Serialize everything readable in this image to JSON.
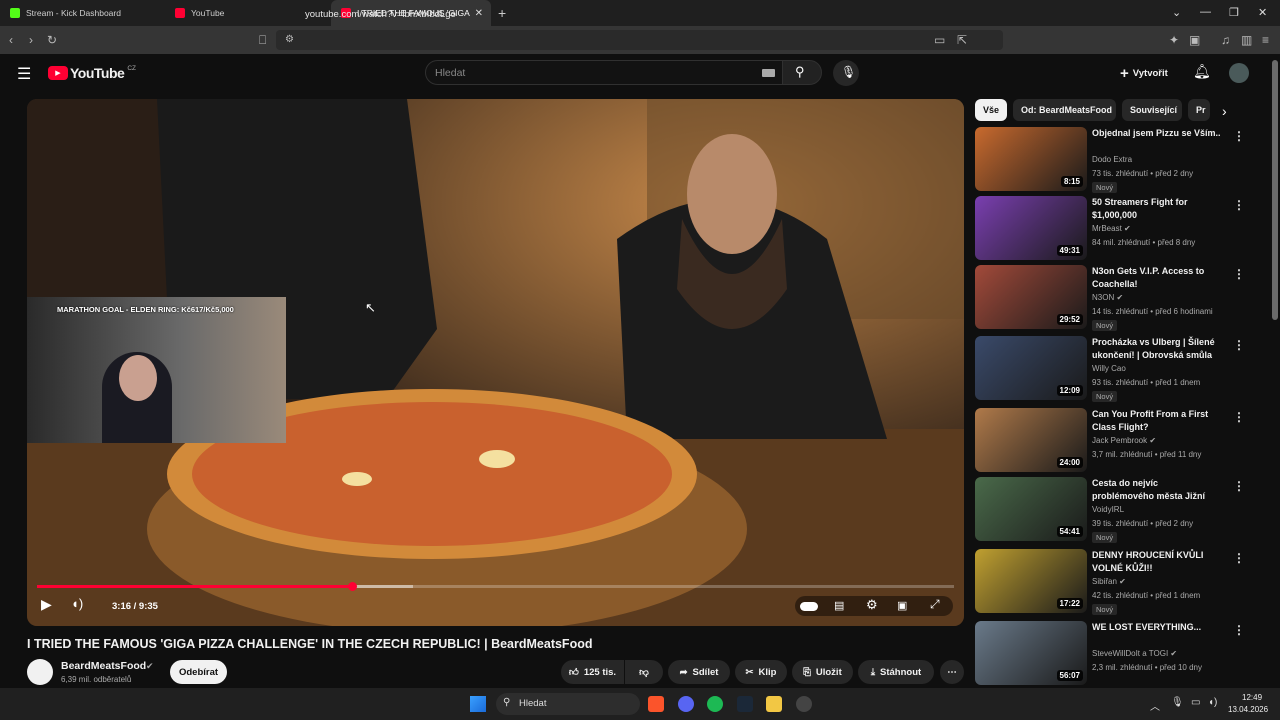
{
  "browser": {
    "tabs": [
      {
        "label": "Stream - Kick Dashboard",
        "color": "#53fc18"
      },
      {
        "label": "YouTube",
        "color": "#ff0033"
      },
      {
        "label": "I TRIED THE FAMOUS 'GIGA PIZZ",
        "color": "#ff0033"
      }
    ],
    "url": "youtube.com/watch?v=lbhXbIbdLgo"
  },
  "youtube": {
    "logo_text": "YouTube",
    "region": "CZ",
    "search_placeholder": "Hledat",
    "create_label": "Vytvořit"
  },
  "video": {
    "overlay_goal": "MARATHON GOAL - ELDEN RING: Kč617/Kč5,000",
    "time": "3:16 / 9:35",
    "progress": 0.343,
    "buffered": 0.41,
    "title": "I TRIED THE FAMOUS 'GIGA PIZZA CHALLENGE' IN THE CZECH REPUBLIC! | BeardMeatsFood",
    "channel": "BeardMeatsFood",
    "subscribers": "6,39 mil. odběratelů",
    "subscribe_label": "Odebírat",
    "likes": "125 tis.",
    "share_label": "Sdílet",
    "clip_label": "Klip",
    "save_label": "Uložit",
    "download_label": "Stáhnout"
  },
  "chips": [
    "Vše",
    "Od: BeardMeatsFood",
    "Související",
    "Pr"
  ],
  "recommendations": [
    {
      "title": "Objednal jsem Pizzu se Vším..",
      "channel": "Dodo Extra",
      "meta": "73 tis. zhlédnutí • před 2 dny",
      "duration": "8:15",
      "badge": "Nový",
      "verified": false,
      "thumb": "#c96a2e"
    },
    {
      "title": "50 Streamers Fight for $1,000,000",
      "channel": "MrBeast",
      "meta": "84 mil. zhlédnutí • před 8 dny",
      "duration": "49:31",
      "badge": "",
      "verified": true,
      "thumb": "#7a3fb0"
    },
    {
      "title": "N3on Gets V.I.P. Access to Coachella!",
      "channel": "N3ON",
      "meta": "14 tis. zhlédnutí • před 6 hodinami",
      "duration": "29:52",
      "badge": "Nový",
      "verified": true,
      "thumb": "#a24a3a"
    },
    {
      "title": "Procházka vs Ulberg | Šílené ukončení! | Obrovská smůla ...",
      "channel": "Willy Cao",
      "meta": "93 tis. zhlédnutí • před 1 dnem",
      "duration": "12:09",
      "badge": "Nový",
      "verified": false,
      "thumb": "#3a4a6a"
    },
    {
      "title": "Can You Profit From a First Class Flight?",
      "channel": "Jack Pembrook",
      "meta": "3,7 mil. zhlédnutí • před 11 dny",
      "duration": "24:00",
      "badge": "",
      "verified": true,
      "thumb": "#b07a4a"
    },
    {
      "title": "Cesta do nejvíc problémového města Jižní Ameriky podle ...",
      "channel": "VoidyIRL",
      "meta": "39 tis. zhlédnutí • před 2 dny",
      "duration": "54:41",
      "badge": "Nový",
      "verified": false,
      "thumb": "#4a6a4a"
    },
    {
      "title": "DENNY HROUCENÍ KVŮLI VOLNÉ KŮŽI!!",
      "channel": "Sibiřan",
      "meta": "42 tis. zhlédnutí • před 1 dnem",
      "duration": "17:22",
      "badge": "Nový",
      "verified": true,
      "thumb": "#c0a030"
    },
    {
      "title": "WE LOST EVERYTHING...",
      "channel": "SteveWillDoIt",
      "channel2": "a TOGI",
      "meta": "2,3 mil. zhlédnutí • před 10 dny",
      "duration": "56:07",
      "badge": "",
      "verified": true,
      "thumb": "#6a7a8a"
    }
  ],
  "taskbar": {
    "search_placeholder": "Hledat",
    "time": "12:49",
    "date": "13.04.2026"
  }
}
